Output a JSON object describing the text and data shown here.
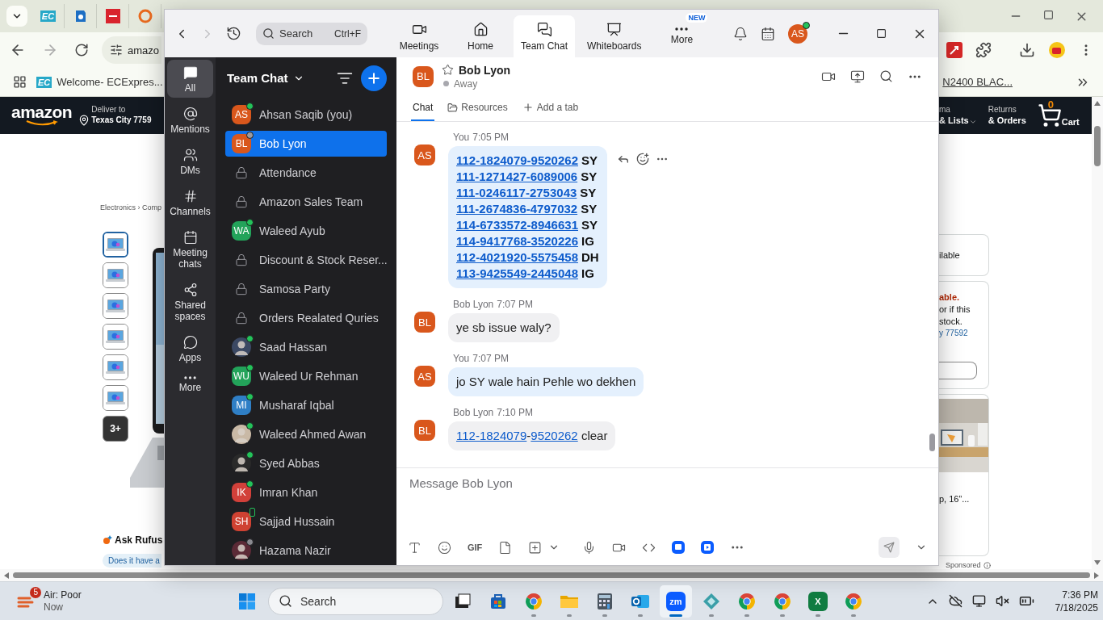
{
  "browser": {
    "pinned_tabs": [
      {
        "kind": "ec",
        "text": "EC"
      },
      {
        "kind": "doc"
      },
      {
        "kind": "dh"
      },
      {
        "kind": "sync"
      }
    ],
    "address": "amazo",
    "bookmark": {
      "icon_text": "EC",
      "label": "Welcome- ECExpres..."
    },
    "bookmark_right": "N2400 BLAC..."
  },
  "amazon": {
    "logo": "amazon",
    "deliver_label": "Deliver to",
    "deliver_city": "Texas City 7759",
    "account_line1": "ma",
    "account_line2": "& Lists",
    "returns_line1": "Returns",
    "returns_line2": "& Orders",
    "cart_count": "0",
    "cart_label": "Cart",
    "breadcrumb": "Electronics › Comp",
    "thumbnails": [
      {
        "kind": "picture",
        "selected": true
      },
      {
        "kind": "picture",
        "selected": false
      },
      {
        "kind": "picture",
        "selected": false
      },
      {
        "kind": "picture",
        "selected": false
      },
      {
        "kind": "picture",
        "selected": false
      },
      {
        "kind": "picture",
        "selected": false
      },
      {
        "kind": "more",
        "text": "3+",
        "selected": false
      }
    ],
    "ask_label": "Ask Rufus",
    "ask_chip": "Does it have a",
    "availability": "ilable",
    "stock_alert": "able.",
    "stock_lines": [
      "or if this",
      "stock."
    ],
    "stock_location": "y 77592",
    "product_title": "p, 16”...",
    "sponsored": "Sponsored"
  },
  "zoom": {
    "forward_disabled": true,
    "search": {
      "placeholder": "Search",
      "shortcut": "Ctrl+F"
    },
    "nav": [
      {
        "label": "Meetings",
        "selected": false
      },
      {
        "label": "Home",
        "selected": false
      },
      {
        "label": "Team Chat",
        "selected": true
      },
      {
        "label": "Whiteboards",
        "selected": false
      },
      {
        "label": "More",
        "badge": "NEW",
        "selected": false
      }
    ],
    "profile": {
      "initials": "AS",
      "status": {
        "kind": "dot",
        "color": "#23c35a"
      }
    },
    "rail": [
      {
        "label": "All",
        "selected": true
      },
      {
        "label": "Mentions",
        "selected": false
      },
      {
        "label": "DMs",
        "selected": false
      },
      {
        "label": "Channels",
        "selected": false
      },
      {
        "label": "Meeting chats",
        "selected": false
      },
      {
        "label": "Shared spaces",
        "selected": false
      },
      {
        "label": "Apps",
        "selected": false
      },
      {
        "label": "More",
        "selected": false
      }
    ],
    "list_title": "Team Chat",
    "chats": [
      {
        "name": "Ahsan Saqib (you)",
        "kind": "person",
        "initials": "AS",
        "color": "#d9571c",
        "status": {
          "kind": "dot",
          "color": "#23c35a"
        },
        "selected": false
      },
      {
        "name": "Bob Lyon",
        "kind": "person",
        "initials": "BL",
        "color": "#d9571c",
        "status": {
          "kind": "dot",
          "color": "#9a9aa0"
        },
        "selected": true
      },
      {
        "name": "Attendance",
        "kind": "channel",
        "selected": false
      },
      {
        "name": "Amazon Sales Team",
        "kind": "channel",
        "selected": false
      },
      {
        "name": "Waleed Ayub",
        "kind": "person",
        "initials": "WA",
        "color": "#23a35a",
        "status": {
          "kind": "dot",
          "color": "#23c35a"
        },
        "selected": false
      },
      {
        "name": "Discount & Stock Reser...",
        "kind": "channel",
        "selected": false
      },
      {
        "name": "Samosa Party",
        "kind": "channel",
        "selected": false
      },
      {
        "name": "Orders Realated Quries",
        "kind": "channel",
        "selected": false
      },
      {
        "name": "Saad Hassan",
        "color": "#3b4863",
        "status": {
          "kind": "dot",
          "color": "#23c35a"
        },
        "selected": false
      },
      {
        "name": "Waleed Ur Rehman",
        "kind": "person",
        "initials": "WU",
        "color": "#23a35a",
        "status": {
          "kind": "dot",
          "color": "#23c35a"
        },
        "selected": false
      },
      {
        "name": "Musharaf Iqbal",
        "kind": "person",
        "initials": "MI",
        "color": "#2f7fc6",
        "status": {
          "kind": "dot",
          "color": "#23c35a"
        },
        "selected": false
      },
      {
        "name": "Waleed Ahmed Awan",
        "color": "#c9b9a6",
        "status": {
          "kind": "dot",
          "color": "#23c35a"
        },
        "selected": false
      },
      {
        "name": "Syed Abbas",
        "color": "#2a2a2a",
        "status": {
          "kind": "dot",
          "color": "#23c35a"
        },
        "selected": false
      },
      {
        "name": "Imran Khan",
        "kind": "person",
        "initials": "IK",
        "color": "#d2403a",
        "status": {
          "kind": "dot",
          "color": "#23c35a"
        },
        "selected": false
      },
      {
        "name": "Sajjad Hussain",
        "kind": "person",
        "initials": "SH",
        "color": "#cf4232",
        "status": {
          "kind": "phone",
          "color": "#23c35a"
        },
        "selected": false
      },
      {
        "name": "Hazama Nazir",
        "color": "#5b2a36",
        "status": {
          "kind": "clock",
          "color": "#8a8a90"
        },
        "selected": false
      }
    ],
    "conversation": {
      "initials": "BL",
      "name": "Bob Lyon",
      "starred": false,
      "presence": "Away",
      "tabs": [
        {
          "label": "Chat",
          "selected": true
        },
        {
          "label": "Resources",
          "selected": false
        },
        {
          "label": "Add a tab",
          "selected": false
        }
      ],
      "messages": [
        {
          "sender": "You",
          "time": "7:05 PM",
          "initials": "AS",
          "mine": true,
          "kind": "orders",
          "show_actions": true,
          "lines": [
            {
              "order": "112-1824079-9520262",
              "code": "SY"
            },
            {
              "order": "111-1271427-6089006",
              "code": "SY"
            },
            {
              "order": "111-0246117-2753043",
              "code": "SY"
            },
            {
              "order": "111-2674836-4797032",
              "code": "SY"
            },
            {
              "order": "114-6733572-8946631",
              "code": "SY"
            },
            {
              "order": "114-9417768-3520226",
              "code": "IG"
            },
            {
              "order": "112-4021920-5575458",
              "code": "DH"
            },
            {
              "order": "113-9425549-2445048",
              "code": "IG"
            }
          ]
        },
        {
          "sender": "Bob Lyon",
          "time": "7:07 PM",
          "initials": "BL",
          "mine": false,
          "kind": "text",
          "show_actions": false,
          "parts": [
            {
              "text": "ye sb issue waly?",
              "link": false
            }
          ]
        },
        {
          "sender": "You",
          "time": "7:07 PM",
          "initials": "AS",
          "mine": true,
          "kind": "text",
          "show_actions": false,
          "parts": [
            {
              "text": "jo SY wale hain Pehle wo dekhen",
              "link": false
            }
          ]
        },
        {
          "sender": "Bob Lyon",
          "time": "7:10 PM",
          "initials": "BL",
          "mine": false,
          "kind": "text",
          "show_actions": false,
          "parts": [
            {
              "text": "112-1824079",
              "link": true
            },
            {
              "text": "-",
              "link": false
            },
            {
              "text": "9520262",
              "link": true
            },
            {
              "text": " clear",
              "link": false
            }
          ]
        }
      ]
    },
    "composer": {
      "placeholder": "Message Bob Lyon",
      "gif_label": "GIF"
    }
  },
  "taskbar": {
    "weather": {
      "badge": "5",
      "title": "Air: Poor",
      "subtitle": "Now"
    },
    "search": "Search",
    "apps": [
      {
        "kind": "taskview",
        "running": false,
        "selected": false
      },
      {
        "kind": "store",
        "running": false,
        "selected": false
      },
      {
        "kind": "chrome",
        "running": true,
        "selected": false
      },
      {
        "kind": "folder",
        "running": true,
        "selected": false
      },
      {
        "kind": "calculator",
        "running": true,
        "selected": false
      },
      {
        "kind": "outlook",
        "running": true,
        "selected": false
      },
      {
        "kind": "zoom",
        "text": "zm",
        "running": true,
        "selected": true
      },
      {
        "kind": "diamond",
        "running": true,
        "selected": false
      },
      {
        "kind": "chrome",
        "running": true,
        "selected": false
      },
      {
        "kind": "chrome",
        "running": true,
        "selected": false
      },
      {
        "kind": "excel",
        "text": "X",
        "running": true,
        "selected": false
      },
      {
        "kind": "chrome",
        "running": true,
        "selected": false
      }
    ],
    "time": "7:36 PM",
    "date": "7/18/2025"
  }
}
